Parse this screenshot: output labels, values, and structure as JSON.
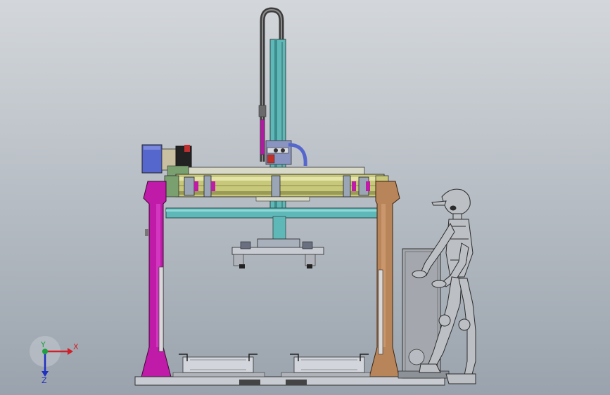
{
  "view": {
    "background_top": "#d3d7db",
    "background_bottom": "#9aa3ad"
  },
  "triad": {
    "x_label": "X",
    "y_label": "Y",
    "z_label": "Z",
    "x_color": "#d0202a",
    "y_color": "#20a040",
    "z_color": "#2030c0"
  },
  "model": {
    "left_column_color": "#c01aa8",
    "right_column_color": "#b8845a",
    "beam_color": "#5fb8b8",
    "rail_color": "#c8c87a",
    "vertical_mast_color": "#5fb8b8",
    "cable_loop_color": "#555555",
    "motor_color": "#5566cc"
  }
}
